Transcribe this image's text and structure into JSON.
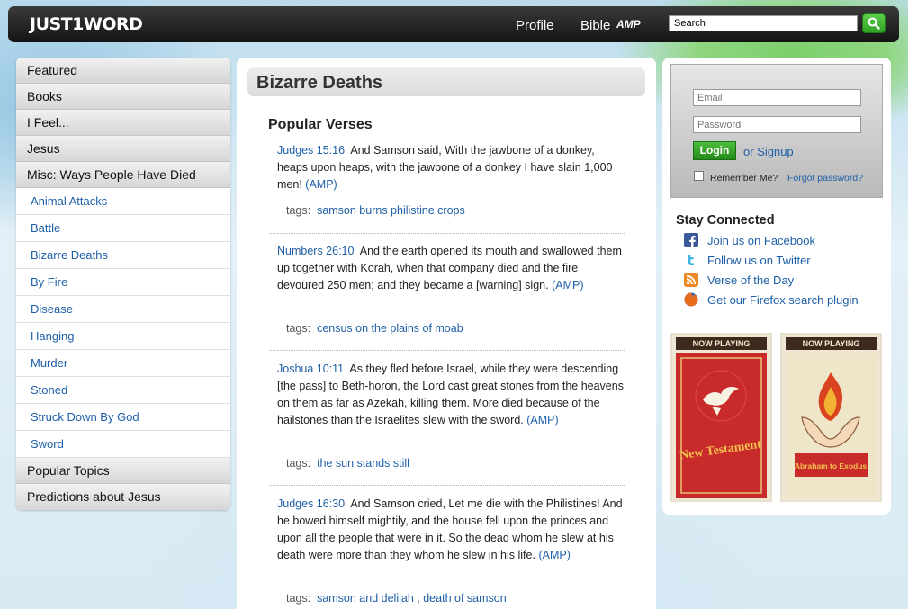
{
  "header": {
    "logo": "JUST1WORD",
    "nav": {
      "profile": "Profile",
      "bible": "Bible",
      "amp": "AMP"
    },
    "search_placeholder": "Search"
  },
  "sidebar": {
    "categories_top": [
      "Featured",
      "Books",
      "I Feel...",
      "Jesus",
      "Misc: Ways People Have Died"
    ],
    "subitems": [
      "Animal Attacks",
      "Battle",
      "Bizarre Deaths",
      "By Fire",
      "Disease",
      "Hanging",
      "Murder",
      "Stoned",
      "Struck Down By God",
      "Sword"
    ],
    "categories_bottom": [
      "Popular Topics",
      "Predictions about Jesus"
    ]
  },
  "main": {
    "title": "Bizarre Deaths",
    "section_title": "Popular Verses",
    "tags_label": "tags:",
    "verses": [
      {
        "ref": "Judges 15:16",
        "text": "And Samson said, With the jawbone of a donkey, heaps upon heaps, with the jawbone of a donkey I have slain 1,000 men!",
        "amp": "(AMP)",
        "tags": [
          "samson burns philistine crops"
        ]
      },
      {
        "ref": "Numbers 26:10",
        "text": "And the earth opened its mouth and swallowed them up together with Korah, when that company died and the fire devoured 250 men; and they became a [warning] sign.",
        "amp": "(AMP)",
        "tags": [
          "census on the plains of moab"
        ]
      },
      {
        "ref": "Joshua 10:11",
        "text": "As they fled before Israel, while they were descending [the pass] to Beth-horon, the Lord cast great stones from the heavens on them as far as Azekah, killing them. More died because of the hailstones than the Israelites slew with the sword.",
        "amp": "(AMP)",
        "tags": [
          "the sun stands still"
        ]
      },
      {
        "ref": "Judges 16:30",
        "text": "And Samson cried, Let me die with the Philistines! And he bowed himself mightily, and the house fell upon the princes and upon all the people that were in it. So the dead whom he slew at his death were more than they whom he slew in his life.",
        "amp": "(AMP)",
        "tags": [
          "samson and delilah",
          "death of samson"
        ],
        "tag_separator": ","
      }
    ]
  },
  "login": {
    "email_placeholder": "Email",
    "password_placeholder": "Password",
    "login_label": "Login",
    "signup_label": "or Signup",
    "remember_label": "Remember Me?",
    "forgot_label": "Forgot password?"
  },
  "stay_connected": {
    "title": "Stay Connected",
    "items": [
      {
        "label": "Join us on Facebook",
        "icon": "facebook-icon"
      },
      {
        "label": "Follow us on Twitter",
        "icon": "twitter-icon"
      },
      {
        "label": "Verse of the Day",
        "icon": "rss-icon"
      },
      {
        "label": "Get our Firefox search plugin",
        "icon": "firefox-icon"
      }
    ]
  },
  "posters": [
    {
      "badge": "NOW PLAYING",
      "title": "New Testament"
    },
    {
      "badge": "NOW PLAYING",
      "title": "Abraham to Exodus"
    }
  ],
  "colors": {
    "link": "#1e5fa8",
    "accent_green": "#2f9f25",
    "topbar": "#1a1a1a"
  }
}
